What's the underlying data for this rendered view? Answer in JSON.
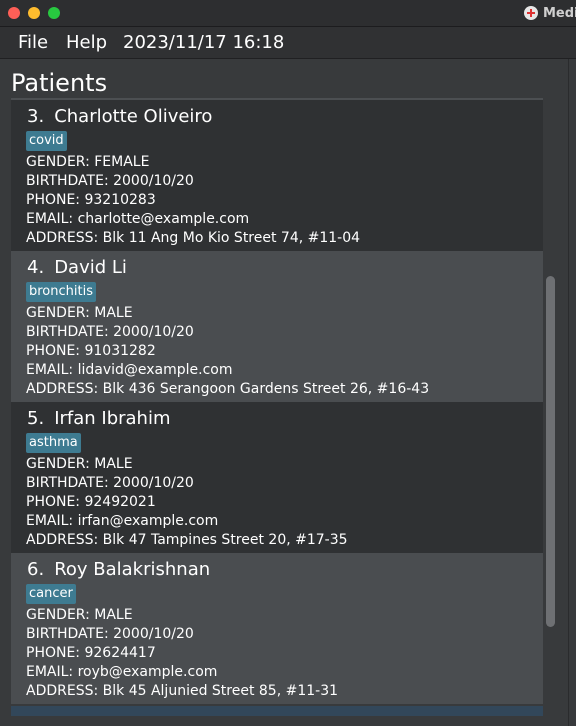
{
  "window": {
    "app_title": "Medi"
  },
  "menu": {
    "file": "File",
    "help": "Help",
    "datetime": "2023/11/17 16:18"
  },
  "panel": {
    "title": "Patients"
  },
  "patients": [
    {
      "index": "3.",
      "name": "Charlotte Oliveiro",
      "tag": "covid",
      "gender": "GENDER: FEMALE",
      "birthdate": "BIRTHDATE: 2000/10/20",
      "phone": "PHONE: 93210283",
      "email": "EMAIL: charlotte@example.com",
      "address": "ADDRESS: Blk 11 Ang Mo Kio Street 74, #11-04"
    },
    {
      "index": "4.",
      "name": "David Li",
      "tag": "bronchitis",
      "gender": "GENDER: MALE",
      "birthdate": "BIRTHDATE: 2000/10/20",
      "phone": "PHONE: 91031282",
      "email": "EMAIL: lidavid@example.com",
      "address": "ADDRESS: Blk 436 Serangoon Gardens Street 26, #16-43"
    },
    {
      "index": "5.",
      "name": "Irfan Ibrahim",
      "tag": "asthma",
      "gender": "GENDER: MALE",
      "birthdate": "BIRTHDATE: 2000/10/20",
      "phone": "PHONE: 92492021",
      "email": "EMAIL: irfan@example.com",
      "address": "ADDRESS: Blk 47 Tampines Street 20, #17-35"
    },
    {
      "index": "6.",
      "name": "Roy Balakrishnan",
      "tag": "cancer",
      "gender": "GENDER: MALE",
      "birthdate": "BIRTHDATE: 2000/10/20",
      "phone": "PHONE: 92624417",
      "email": "EMAIL: royb@example.com",
      "address": "ADDRESS: Blk 45 Aljunied Street 85, #11-31"
    }
  ],
  "colors": {
    "tag_background": "#3e7b91",
    "card_dark": "#2f3133",
    "card_light": "#4a4d50"
  }
}
